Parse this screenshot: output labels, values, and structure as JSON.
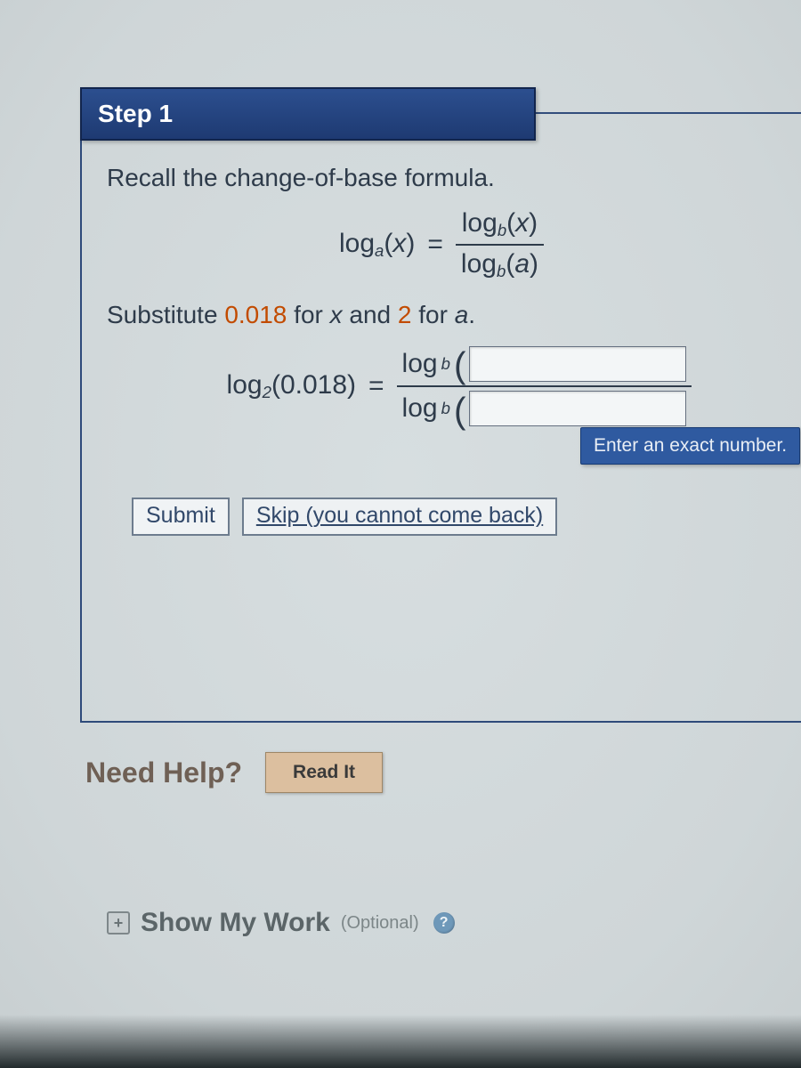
{
  "step": {
    "title": "Step 1"
  },
  "body": {
    "recall_text": "Recall the change-of-base formula.",
    "formula": {
      "lhs_log": "log",
      "lhs_sub": "a",
      "lhs_arg": "x",
      "eq": "=",
      "num_log": "log",
      "num_sub": "b",
      "num_arg": "x",
      "den_log": "log",
      "den_sub": "b",
      "den_arg": "a"
    },
    "substitute_prefix": "Substitute ",
    "substitute_x_value": "0.018",
    "substitute_mid": " for ",
    "substitute_x_var": "x",
    "substitute_and": " and ",
    "substitute_a_value": "2",
    "substitute_for2": " for ",
    "substitute_a_var": "a",
    "substitute_suffix": ".",
    "equation2": {
      "lhs_log": "log",
      "lhs_sub": "2",
      "lhs_arg": "0.018",
      "eq": "=",
      "rhs_log": "log",
      "rhs_sub": "b"
    }
  },
  "tooltip": "Enter an exact number.",
  "buttons": {
    "submit": "Submit",
    "skip": "Skip (you cannot come back)"
  },
  "help": {
    "label": "Need Help?",
    "read_it": "Read It"
  },
  "show_work": {
    "label": "Show My Work",
    "optional": "(Optional)"
  }
}
